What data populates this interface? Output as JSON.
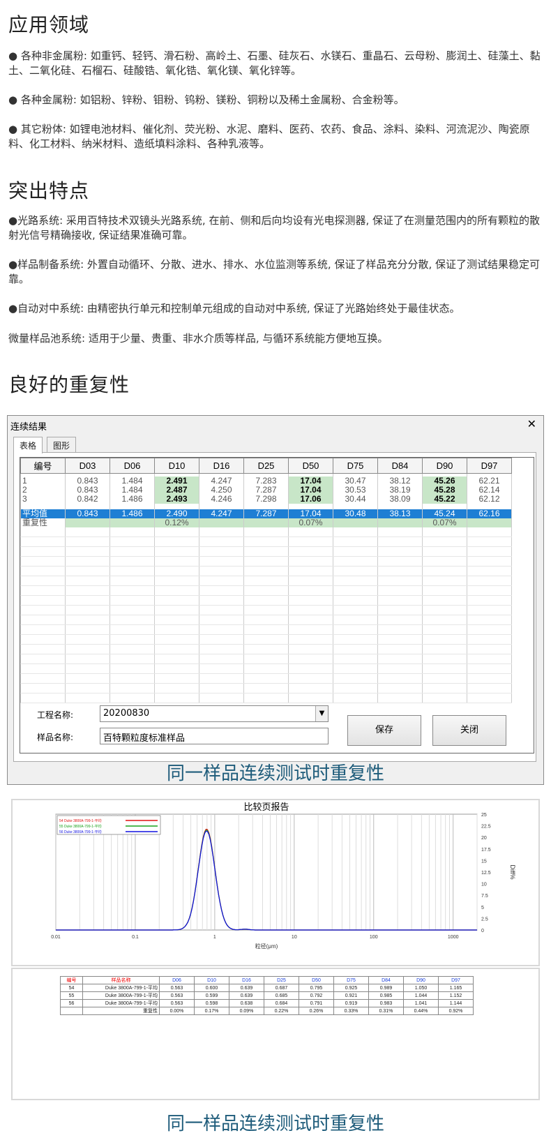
{
  "section1": {
    "title": "应用领域",
    "items": [
      "● 各种非金属粉: 如重钙、轻钙、滑石粉、高岭土、石墨、硅灰石、水镁石、重晶石、云母粉、膨润土、硅藻土、黏土、二氧化硅、石榴石、硅酸锆、氧化锆、氧化镁、氧化锌等。",
      "● 各种金属粉: 如铝粉、锌粉、钼粉、钨粉、镁粉、铜粉以及稀土金属粉、合金粉等。",
      "● 其它粉体: 如锂电池材料、催化剂、荧光粉、水泥、磨料、医药、农药、食品、涂料、染料、河流泥沙、陶瓷原料、化工材料、纳米材料、造纸填料涂料、各种乳液等。"
    ]
  },
  "section2": {
    "title": "突出特点",
    "items": [
      "●光路系统: 采用百特技术双镜头光路系统, 在前、侧和后向均设有光电探测器, 保证了在测量范围内的所有颗粒的散射光信号精确接收, 保证结果准确可靠。",
      "●样品制备系统: 外置自动循环、分散、进水、排水、水位监测等系统, 保证了样品充分分散, 保证了测试结果稳定可靠。",
      "●自动对中系统: 由精密执行单元和控制单元组成的自动对中系统, 保证了光路始终处于最佳状态。",
      "微量样品池系统: 适用于少量、贵重、非水介质等样品, 与循环系统能方便地互换。"
    ]
  },
  "section3": {
    "title": "良好的重复性"
  },
  "dialog": {
    "title": "连续结果",
    "close": "✕",
    "tabs": [
      "表格",
      "图形"
    ],
    "headers": [
      "编号",
      "D03",
      "D06",
      "D10",
      "D16",
      "D25",
      "D50",
      "D75",
      "D84",
      "D90",
      "D97"
    ],
    "rows": [
      [
        "1",
        "0.843",
        "1.484",
        "2.491",
        "4.247",
        "7.283",
        "17.04",
        "30.47",
        "38.12",
        "45.26",
        "62.21"
      ],
      [
        "2",
        "0.843",
        "1.484",
        "2.487",
        "4.250",
        "7.287",
        "17.04",
        "30.53",
        "38.19",
        "45.28",
        "62.14"
      ],
      [
        "3",
        "0.842",
        "1.486",
        "2.493",
        "4.246",
        "7.298",
        "17.06",
        "30.44",
        "38.09",
        "45.22",
        "62.12"
      ]
    ],
    "avg": [
      "平均值",
      "0.843",
      "1.486",
      "2.490",
      "4.247",
      "7.287",
      "17.04",
      "30.48",
      "38.13",
      "45.24",
      "62.16"
    ],
    "rep": [
      "重复性",
      "",
      "",
      "0.12%",
      "",
      "",
      "0.07%",
      "",
      "",
      "0.07%",
      ""
    ],
    "project_label": "工程名称:",
    "project_value": "20200830",
    "sample_label": "样品名称:",
    "sample_value": "百特颗粒度标准样品",
    "save": "保存",
    "close_btn": "关闭"
  },
  "caption1": "同一样品连续测试时重复性",
  "chart_data": {
    "type": "line",
    "title": "比较页报告",
    "xlabel": "粒径(μm)",
    "ylabel": "Diff%",
    "xscale": "log",
    "xlim": [
      0.01,
      2000
    ],
    "ylim": [
      0,
      25
    ],
    "xticks": [
      "0.01",
      "0.1",
      "1",
      "10",
      "100",
      "1000"
    ],
    "yticks": [
      "0",
      "2.5",
      "5",
      "7.5",
      "10",
      "12.5",
      "15",
      "17.5",
      "20",
      "22.5",
      "25"
    ],
    "legend_position": "top-left",
    "series": [
      {
        "name": "54  Duke 3800A-799-1-平均",
        "color": "#e01010",
        "peak_x": 0.79,
        "peak_y": 21.8
      },
      {
        "name": "55  Duke 3800A-799-1-平均",
        "color": "#18a018",
        "peak_x": 0.79,
        "peak_y": 21.6
      },
      {
        "name": "56  Duke 3800A-799-1-平均",
        "color": "#1010e0",
        "peak_x": 0.79,
        "peak_y": 21.4
      }
    ]
  },
  "cmp_table": {
    "headers": [
      "编号",
      "样品名称",
      "D06",
      "D10",
      "D16",
      "D25",
      "D50",
      "D75",
      "D84",
      "D90",
      "D97"
    ],
    "rows": [
      [
        "54",
        "Duke 3800A-799-1-平均",
        "0.563",
        "0.600",
        "0.639",
        "0.687",
        "0.795",
        "0.925",
        "0.989",
        "1.050",
        "1.165"
      ],
      [
        "55",
        "Duke 3800A-799-1-平均",
        "0.563",
        "0.599",
        "0.639",
        "0.685",
        "0.792",
        "0.921",
        "0.985",
        "1.044",
        "1.152"
      ],
      [
        "56",
        "Duke 3800A-799-1-平均",
        "0.563",
        "0.598",
        "0.638",
        "0.684",
        "0.791",
        "0.919",
        "0.983",
        "1.041",
        "1.144"
      ],
      [
        "",
        "重复性",
        "0.00%",
        "0.17%",
        "0.09%",
        "0.22%",
        "0.26%",
        "0.33%",
        "0.31%",
        "0.44%",
        "0.92%"
      ]
    ]
  },
  "caption2": "同一样品连续测试时重复性"
}
